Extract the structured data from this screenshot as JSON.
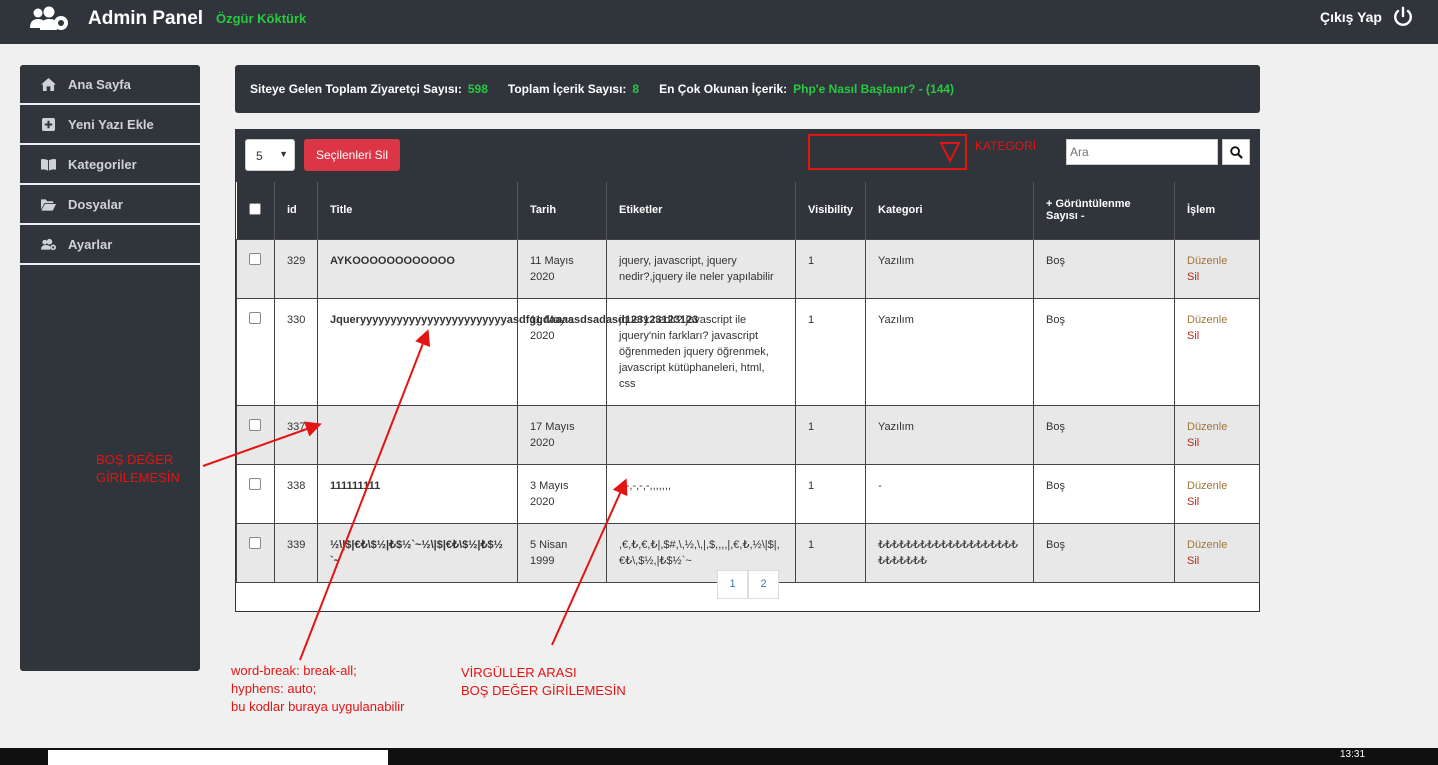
{
  "header": {
    "title": "Admin Panel",
    "user": "Özgür Köktürk",
    "logout": "Çıkış Yap"
  },
  "sidebar": {
    "items": [
      {
        "label": "Ana Sayfa",
        "icon": "home-icon"
      },
      {
        "label": "Yeni Yazı Ekle",
        "icon": "plus-square-icon"
      },
      {
        "label": "Kategoriler",
        "icon": "book-icon"
      },
      {
        "label": "Dosyalar",
        "icon": "folder-open-icon"
      },
      {
        "label": "Ayarlar",
        "icon": "users-cog-icon"
      }
    ]
  },
  "stats": {
    "visitors_label": "Siteye Gelen Toplam Ziyaretçi Sayısı:",
    "visitors_value": "598",
    "content_label": "Toplam İçerik Sayısı:",
    "content_value": "8",
    "most_read_label": "En Çok Okunan İçerik:",
    "most_read_value": "Php'e Nasıl Başlanır? - (144)"
  },
  "toolbar": {
    "page_size": "5",
    "delete_selected": "Seçilenleri Sil",
    "category_filter_label": "KATEGORİ",
    "search_placeholder": "Ara"
  },
  "table": {
    "headers": {
      "id": "id",
      "title": "Title",
      "date": "Tarih",
      "tags": "Etiketler",
      "visibility": "Visibility",
      "category": "Kategori",
      "views": "+ Görüntülenme Sayısı -",
      "action": "İşlem"
    },
    "rows": [
      {
        "id": "329",
        "title": "AYKOOOOOOOOOOOO",
        "date": "11 Mayıs 2020",
        "tags": "jquery, javascript, jquery nedir?,jquery ile neler yapılabilir",
        "visibility": "1",
        "category": "Yazılım",
        "views": "Boş",
        "edit": "Düzenle",
        "delete": "Sil"
      },
      {
        "id": "330",
        "title": "Jqueryyyyyyyyyyyyyyyyyyyyyyyyasdfggdaaaasdsadasd123123123123",
        "date": "11 Mayıs 2020",
        "tags": "jquery nedir? javascript ile jquery'nin farkları? javascript öğrenmeden jquery öğrenmek, javascript kütüphaneleri, html, css",
        "visibility": "1",
        "category": "Yazılım",
        "views": "Boş",
        "edit": "Düzenle",
        "delete": "Sil"
      },
      {
        "id": "337",
        "title": "",
        "date": "17 Mayıs 2020",
        "tags": "",
        "visibility": "1",
        "category": "Yazılım",
        "views": "Boş",
        "edit": "Düzenle",
        "delete": "Sil"
      },
      {
        "id": "338",
        "title": "111111111",
        "date": "3 Mayıs 2020",
        "tags": "-,-,-,-,-,,,,,,,",
        "visibility": "1",
        "category": "-",
        "views": "Boş",
        "edit": "Düzenle",
        "delete": "Sil"
      },
      {
        "id": "339",
        "title": "½\\|$|€₺\\$½|₺$½`~½\\|$|€₺\\$½|₺$½`~",
        "date": "5 Nisan 1999",
        "tags": ",€,₺,€,₺|,$#,\\,½,\\,|,$,,,,|,€,₺,½\\|$|,€₺\\,$½,|₺$½`~",
        "visibility": "1",
        "category": "₺₺₺₺₺₺₺₺₺₺₺₺₺₺₺₺₺₺₺₺₺₺₺₺₺₺₺",
        "views": "Boş",
        "edit": "Düzenle",
        "delete": "Sil"
      }
    ]
  },
  "pagination": {
    "pages": [
      "1",
      "2"
    ]
  },
  "annotations": {
    "empty_value": "BOŞ DEĞER GİRİLEMESİN",
    "css_hint_1": "word-break: break-all;",
    "css_hint_2": "hyphens: auto;",
    "css_hint_3": "bu kodlar buraya uygulanabilir",
    "comma_note_1": "VİRGÜLLER ARASI",
    "comma_note_2": "BOŞ DEĞER GİRİLEMESİN"
  },
  "taskbar": {
    "time": "13:31"
  }
}
